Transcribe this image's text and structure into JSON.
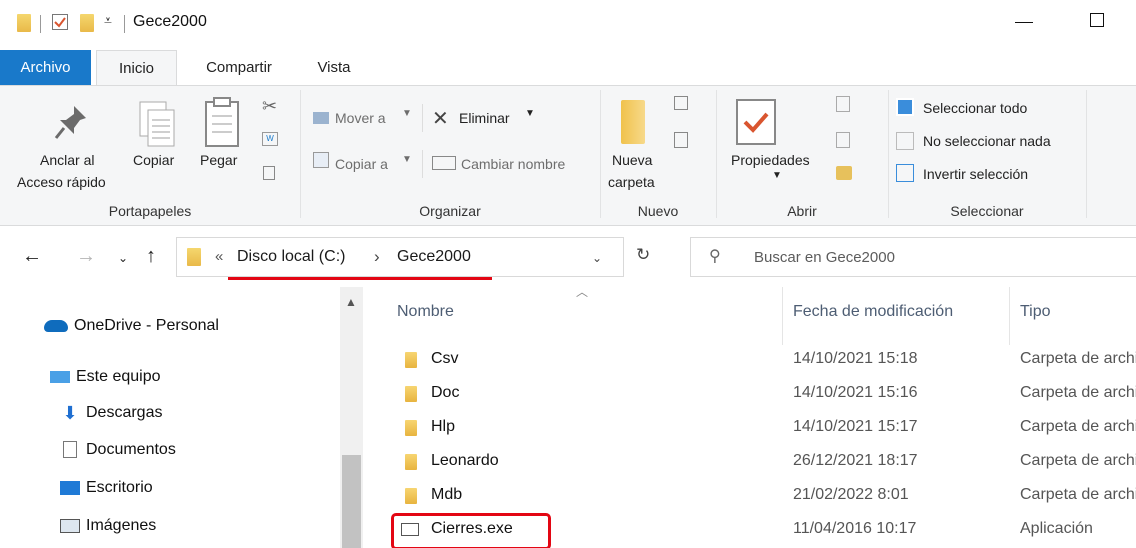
{
  "window": {
    "title": "Gece2000"
  },
  "ribbon_tabs": [
    "Archivo",
    "Inicio",
    "Compartir",
    "Vista"
  ],
  "ribbon": {
    "portapapeles": {
      "pin_label_1": "Anclar al",
      "pin_label_2": "Acceso rápido",
      "copy_label": "Copiar",
      "paste_label": "Pegar",
      "group_label": "Portapapeles"
    },
    "organizar": {
      "move_label": "Mover a",
      "delete_label": "Eliminar",
      "copy_to_label": "Copiar a",
      "rename_label": "Cambiar nombre",
      "group_label": "Organizar"
    },
    "nuevo": {
      "new_folder_1": "Nueva",
      "new_folder_2": "carpeta",
      "group_label": "Nuevo"
    },
    "abrir": {
      "properties_label": "Propiedades",
      "group_label": "Abrir"
    },
    "seleccionar": {
      "select_all": "Seleccionar todo",
      "select_none": "No seleccionar nada",
      "invert": "Invertir selección",
      "group_label": "Seleccionar"
    }
  },
  "address": {
    "overflow": "«",
    "crumbs": [
      "Disco local (C:)",
      "Gece2000"
    ],
    "separator": "›",
    "search_placeholder": "Buscar en Gece2000"
  },
  "nav_pane": [
    {
      "label": "OneDrive - Personal",
      "icon": "cloud-icon"
    },
    {
      "label": "Este equipo",
      "icon": "computer-icon"
    },
    {
      "label": "Descargas",
      "icon": "download-arrow-icon"
    },
    {
      "label": "Documentos",
      "icon": "document-icon"
    },
    {
      "label": "Escritorio",
      "icon": "desktop-icon"
    },
    {
      "label": "Imágenes",
      "icon": "image-icon"
    }
  ],
  "columns": {
    "name": "Nombre",
    "date": "Fecha de modificación",
    "type": "Tipo"
  },
  "files": [
    {
      "name": "Csv",
      "date": "14/10/2021 15:18",
      "type": "Carpeta de archivos",
      "icon": "folder-icon"
    },
    {
      "name": "Doc",
      "date": "14/10/2021 15:16",
      "type": "Carpeta de archivos",
      "icon": "folder-icon"
    },
    {
      "name": "Hlp",
      "date": "14/10/2021 15:17",
      "type": "Carpeta de archivos",
      "icon": "folder-icon"
    },
    {
      "name": "Leonardo",
      "date": "26/12/2021 18:17",
      "type": "Carpeta de archivos",
      "icon": "folder-icon"
    },
    {
      "name": "Mdb",
      "date": "21/02/2022 8:01",
      "type": "Carpeta de archivos",
      "icon": "folder-icon"
    },
    {
      "name": "Cierres.exe",
      "date": "11/04/2016 10:17",
      "type": "Aplicación",
      "icon": "application-icon"
    }
  ],
  "colors": {
    "accent": "#1979ca",
    "annotation": "#e30613"
  }
}
